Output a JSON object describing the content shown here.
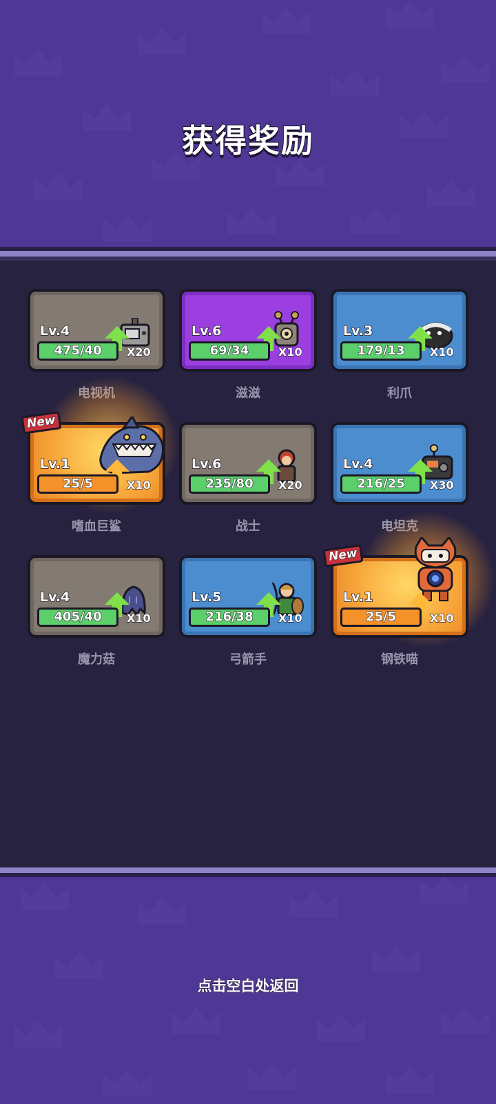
{
  "title": "获得奖励",
  "footer_hint": "点击空白处返回",
  "rewards": [
    {
      "name": "电视机",
      "level": "Lv.4",
      "progress": "475/40",
      "count": "X20",
      "rarity": "grey",
      "is_new": false,
      "icon": "tv-robot-icon"
    },
    {
      "name": "滋滋",
      "level": "Lv.6",
      "progress": "69/34",
      "count": "X10",
      "rarity": "purple",
      "is_new": false,
      "icon": "antenna-robot-icon"
    },
    {
      "name": "利爪",
      "level": "Lv.3",
      "progress": "179/13",
      "count": "X10",
      "rarity": "blue",
      "is_new": false,
      "icon": "badger-icon"
    },
    {
      "name": "嗜血巨鲨",
      "level": "Lv.1",
      "progress": "25/5",
      "count": "X10",
      "rarity": "orange",
      "is_new": true,
      "icon": "shark-icon"
    },
    {
      "name": "战士",
      "level": "Lv.6",
      "progress": "235/80",
      "count": "X20",
      "rarity": "grey",
      "is_new": false,
      "icon": "warrior-icon"
    },
    {
      "name": "电坦克",
      "level": "Lv.4",
      "progress": "216/25",
      "count": "X30",
      "rarity": "blue",
      "is_new": false,
      "icon": "tank-icon"
    },
    {
      "name": "魔力菇",
      "level": "Lv.4",
      "progress": "405/40",
      "count": "X10",
      "rarity": "grey",
      "is_new": false,
      "icon": "mushroom-ghost-icon"
    },
    {
      "name": "弓箭手",
      "level": "Lv.5",
      "progress": "216/38",
      "count": "X10",
      "rarity": "blue",
      "is_new": false,
      "icon": "archer-icon"
    },
    {
      "name": "钢铁喵",
      "level": "Lv.1",
      "progress": "25/5",
      "count": "X10",
      "rarity": "orange",
      "is_new": true,
      "icon": "iron-cat-icon"
    }
  ],
  "new_badge_label": "New",
  "colors": {
    "background": "#4f3795",
    "panel": "#272240",
    "grey_card": "#837a72",
    "purple_card": "#9b3fe0",
    "blue_card": "#4c8dd0",
    "orange_card": "#f8a73b",
    "progress_green": "#5bcf6a",
    "progress_orange": "#f5922a",
    "upgrade_arrow": "#7fe04a"
  }
}
